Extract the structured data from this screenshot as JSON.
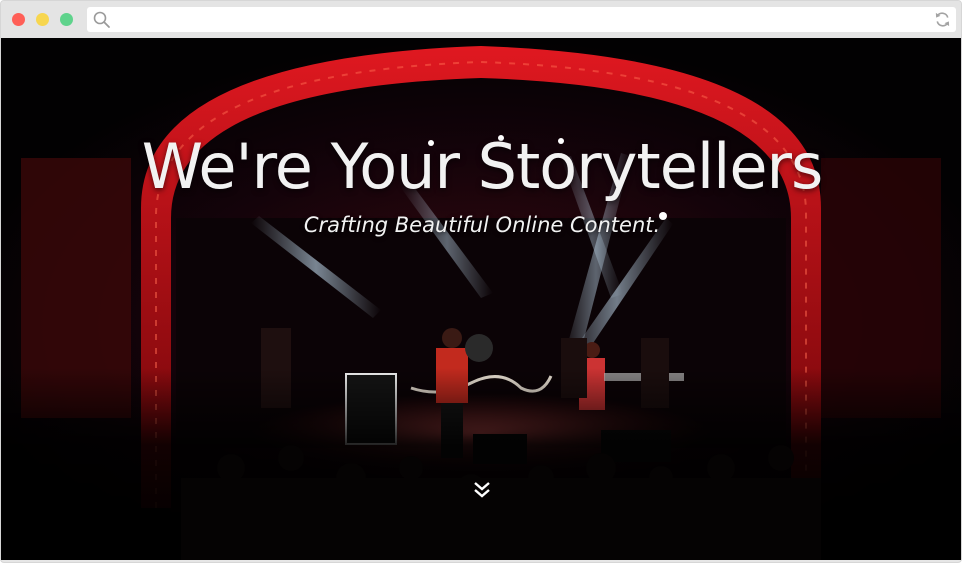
{
  "browser": {
    "address_value": "",
    "address_placeholder": "",
    "icons": {
      "search": "search-icon",
      "refresh": "refresh-icon",
      "scroll": "chevron-double-down-icon"
    },
    "window_controls": {
      "close": "#ff5f57",
      "minimize": "#f7d64f",
      "maximize": "#5fd38c"
    }
  },
  "hero": {
    "title": "We're Your Storytellers",
    "subtitle": "Crafting Beautiful Online Content.",
    "background_image": "concert stage photo",
    "accent_colors": {
      "stage_red": "#c0121a",
      "spotlight": "#bfe3ff",
      "text": "#f2f2f2"
    }
  }
}
